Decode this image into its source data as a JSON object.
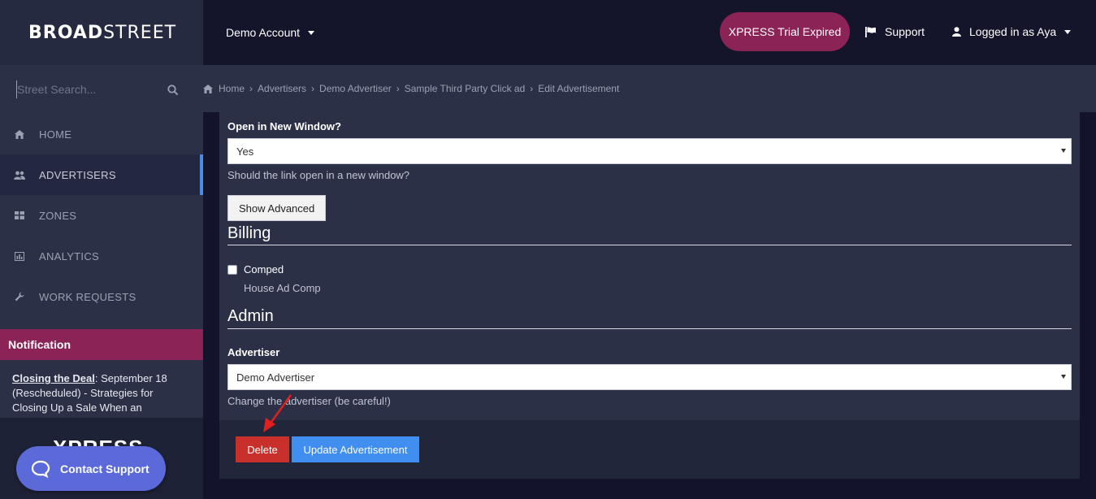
{
  "brand": {
    "logo_bold": "BROAD",
    "logo_light": "STREET"
  },
  "search": {
    "placeholder": "Street Search..."
  },
  "sidebar": {
    "items": [
      {
        "label": "HOME",
        "icon": "home-icon"
      },
      {
        "label": "ADVERTISERS",
        "icon": "users-icon",
        "active": true
      },
      {
        "label": "ZONES",
        "icon": "grid-icon"
      },
      {
        "label": "ANALYTICS",
        "icon": "chart-icon"
      },
      {
        "label": "WORK REQUESTS",
        "icon": "wrench-icon"
      }
    ],
    "notification": {
      "title": "Notification",
      "link_text": "Closing the Deal",
      "text": ": September 18 (Rescheduled) - Strategies for Closing Up a Sale When an"
    },
    "xpress_logo": "XPRESS",
    "contact_support": "Contact Support"
  },
  "topbar": {
    "account": "Demo Account",
    "trial": "XPRESS Trial Expired",
    "support": "Support",
    "login": "Logged in as Aya"
  },
  "breadcrumb": [
    "Home",
    "Advertisers",
    "Demo Advertiser",
    "Sample Third Party Click ad",
    "Edit Advertisement"
  ],
  "form": {
    "new_window_label": "Open in New Window?",
    "new_window_value": "Yes",
    "new_window_help": "Should the link open in a new window?",
    "show_advanced": "Show Advanced",
    "billing_heading": "Billing",
    "comped_label": "Comped",
    "comped_sub": "House Ad Comp",
    "admin_heading": "Admin",
    "advertiser_label": "Advertiser",
    "advertiser_value": "Demo Advertiser",
    "advertiser_help": "Change the advertiser (be careful!)",
    "delete_label": "Delete",
    "update_label": "Update Advertisement"
  },
  "colors": {
    "accent_magenta": "#8c2356",
    "delete_red": "#c9302c",
    "update_blue": "#3f8ef0",
    "sidebar_bg": "#2b3047",
    "topbar_bg": "#14142b",
    "annotation_arrow": "#e0201c"
  }
}
